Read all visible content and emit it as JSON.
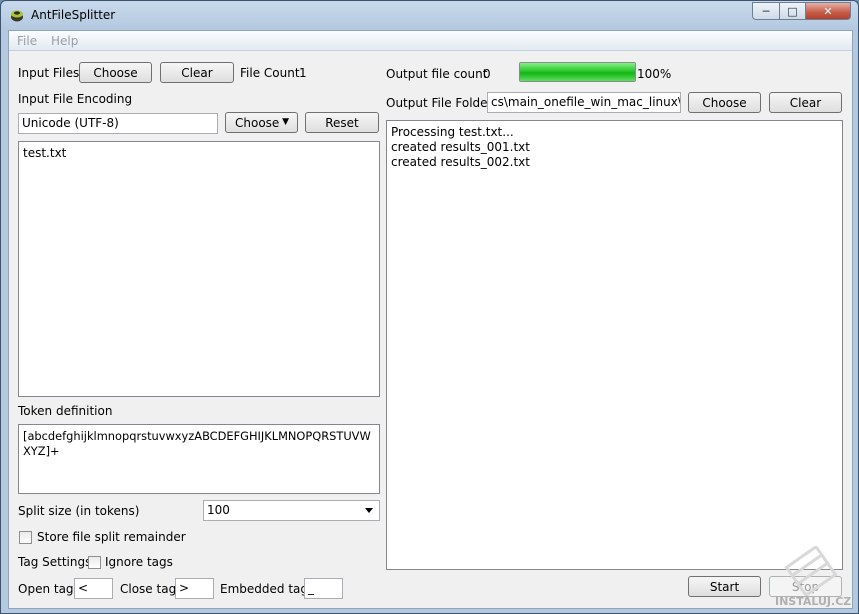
{
  "window": {
    "title": "AntFileSplitter",
    "min_icon": "minimize-icon",
    "max_icon": "maximize-icon",
    "close_icon": "close-icon"
  },
  "menu": [
    "File",
    "Help"
  ],
  "left": {
    "input_files_label": "Input Files",
    "choose_label": "Choose",
    "clear_label": "Clear",
    "file_count_label": "File Count",
    "file_count_value": "1",
    "encoding_label": "Input File Encoding",
    "encoding_value": "Unicode (UTF-8)",
    "encoding_choose_label": "Choose",
    "encoding_reset_label": "Reset",
    "files": [
      "test.txt"
    ],
    "token_label": "Token definition",
    "token_value": "[abcdefghijklmnopqrstuvwxyzABCDEFGHIJKLMNOPQRSTUVWXYZ]+",
    "split_size_label": "Split size (in tokens)",
    "split_size_value": "100",
    "store_remainder_label": "Store file split remainder",
    "store_remainder_checked": false,
    "tag_settings_label": "Tag Settings",
    "ignore_tags_label": "Ignore tags",
    "ignore_tags_checked": false,
    "open_tag_label": "Open tag",
    "open_tag_value": "<",
    "close_tag_label": "Close tag",
    "close_tag_value": ">",
    "embedded_tag_label": "Embedded tag",
    "embedded_tag_value": "_"
  },
  "right": {
    "output_count_label": "Output file count",
    "output_count_value": "0",
    "progress_percent": 100,
    "progress_text": "100%",
    "output_folder_label": "Output File Folder",
    "output_folder_value": "cs\\main_onefile_win_mac_linux\\dist",
    "choose_label": "Choose",
    "clear_label": "Clear",
    "log": [
      "Processing test.txt...",
      "created results_001.txt",
      "created results_002.txt"
    ],
    "start_label": "Start",
    "stop_label": "Stop"
  },
  "watermark_text": "INSTALUJ.CZ",
  "colors": {
    "progress": "#22c322",
    "titlebar": "#b4c9e0"
  }
}
